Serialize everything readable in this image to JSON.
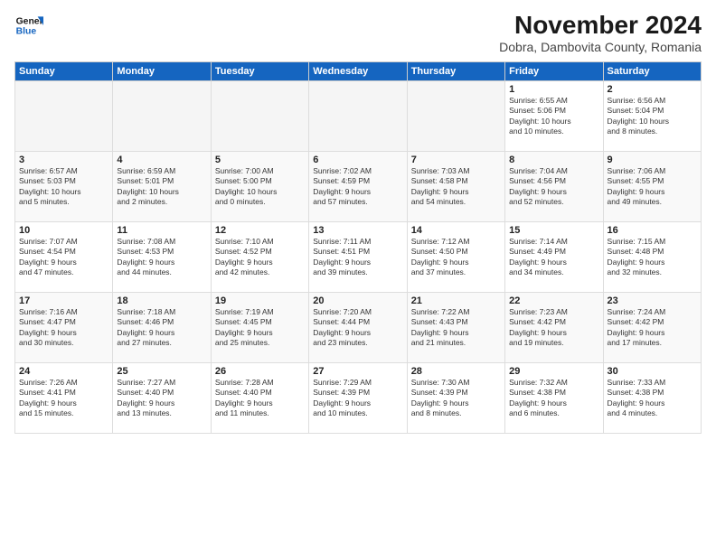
{
  "logo": {
    "line1": "General",
    "line2": "Blue"
  },
  "title": "November 2024",
  "subtitle": "Dobra, Dambovita County, Romania",
  "weekdays": [
    "Sunday",
    "Monday",
    "Tuesday",
    "Wednesday",
    "Thursday",
    "Friday",
    "Saturday"
  ],
  "weeks": [
    [
      {
        "day": "",
        "detail": ""
      },
      {
        "day": "",
        "detail": ""
      },
      {
        "day": "",
        "detail": ""
      },
      {
        "day": "",
        "detail": ""
      },
      {
        "day": "",
        "detail": ""
      },
      {
        "day": "1",
        "detail": "Sunrise: 6:55 AM\nSunset: 5:06 PM\nDaylight: 10 hours\nand 10 minutes."
      },
      {
        "day": "2",
        "detail": "Sunrise: 6:56 AM\nSunset: 5:04 PM\nDaylight: 10 hours\nand 8 minutes."
      }
    ],
    [
      {
        "day": "3",
        "detail": "Sunrise: 6:57 AM\nSunset: 5:03 PM\nDaylight: 10 hours\nand 5 minutes."
      },
      {
        "day": "4",
        "detail": "Sunrise: 6:59 AM\nSunset: 5:01 PM\nDaylight: 10 hours\nand 2 minutes."
      },
      {
        "day": "5",
        "detail": "Sunrise: 7:00 AM\nSunset: 5:00 PM\nDaylight: 10 hours\nand 0 minutes."
      },
      {
        "day": "6",
        "detail": "Sunrise: 7:02 AM\nSunset: 4:59 PM\nDaylight: 9 hours\nand 57 minutes."
      },
      {
        "day": "7",
        "detail": "Sunrise: 7:03 AM\nSunset: 4:58 PM\nDaylight: 9 hours\nand 54 minutes."
      },
      {
        "day": "8",
        "detail": "Sunrise: 7:04 AM\nSunset: 4:56 PM\nDaylight: 9 hours\nand 52 minutes."
      },
      {
        "day": "9",
        "detail": "Sunrise: 7:06 AM\nSunset: 4:55 PM\nDaylight: 9 hours\nand 49 minutes."
      }
    ],
    [
      {
        "day": "10",
        "detail": "Sunrise: 7:07 AM\nSunset: 4:54 PM\nDaylight: 9 hours\nand 47 minutes."
      },
      {
        "day": "11",
        "detail": "Sunrise: 7:08 AM\nSunset: 4:53 PM\nDaylight: 9 hours\nand 44 minutes."
      },
      {
        "day": "12",
        "detail": "Sunrise: 7:10 AM\nSunset: 4:52 PM\nDaylight: 9 hours\nand 42 minutes."
      },
      {
        "day": "13",
        "detail": "Sunrise: 7:11 AM\nSunset: 4:51 PM\nDaylight: 9 hours\nand 39 minutes."
      },
      {
        "day": "14",
        "detail": "Sunrise: 7:12 AM\nSunset: 4:50 PM\nDaylight: 9 hours\nand 37 minutes."
      },
      {
        "day": "15",
        "detail": "Sunrise: 7:14 AM\nSunset: 4:49 PM\nDaylight: 9 hours\nand 34 minutes."
      },
      {
        "day": "16",
        "detail": "Sunrise: 7:15 AM\nSunset: 4:48 PM\nDaylight: 9 hours\nand 32 minutes."
      }
    ],
    [
      {
        "day": "17",
        "detail": "Sunrise: 7:16 AM\nSunset: 4:47 PM\nDaylight: 9 hours\nand 30 minutes."
      },
      {
        "day": "18",
        "detail": "Sunrise: 7:18 AM\nSunset: 4:46 PM\nDaylight: 9 hours\nand 27 minutes."
      },
      {
        "day": "19",
        "detail": "Sunrise: 7:19 AM\nSunset: 4:45 PM\nDaylight: 9 hours\nand 25 minutes."
      },
      {
        "day": "20",
        "detail": "Sunrise: 7:20 AM\nSunset: 4:44 PM\nDaylight: 9 hours\nand 23 minutes."
      },
      {
        "day": "21",
        "detail": "Sunrise: 7:22 AM\nSunset: 4:43 PM\nDaylight: 9 hours\nand 21 minutes."
      },
      {
        "day": "22",
        "detail": "Sunrise: 7:23 AM\nSunset: 4:42 PM\nDaylight: 9 hours\nand 19 minutes."
      },
      {
        "day": "23",
        "detail": "Sunrise: 7:24 AM\nSunset: 4:42 PM\nDaylight: 9 hours\nand 17 minutes."
      }
    ],
    [
      {
        "day": "24",
        "detail": "Sunrise: 7:26 AM\nSunset: 4:41 PM\nDaylight: 9 hours\nand 15 minutes."
      },
      {
        "day": "25",
        "detail": "Sunrise: 7:27 AM\nSunset: 4:40 PM\nDaylight: 9 hours\nand 13 minutes."
      },
      {
        "day": "26",
        "detail": "Sunrise: 7:28 AM\nSunset: 4:40 PM\nDaylight: 9 hours\nand 11 minutes."
      },
      {
        "day": "27",
        "detail": "Sunrise: 7:29 AM\nSunset: 4:39 PM\nDaylight: 9 hours\nand 10 minutes."
      },
      {
        "day": "28",
        "detail": "Sunrise: 7:30 AM\nSunset: 4:39 PM\nDaylight: 9 hours\nand 8 minutes."
      },
      {
        "day": "29",
        "detail": "Sunrise: 7:32 AM\nSunset: 4:38 PM\nDaylight: 9 hours\nand 6 minutes."
      },
      {
        "day": "30",
        "detail": "Sunrise: 7:33 AM\nSunset: 4:38 PM\nDaylight: 9 hours\nand 4 minutes."
      }
    ]
  ]
}
